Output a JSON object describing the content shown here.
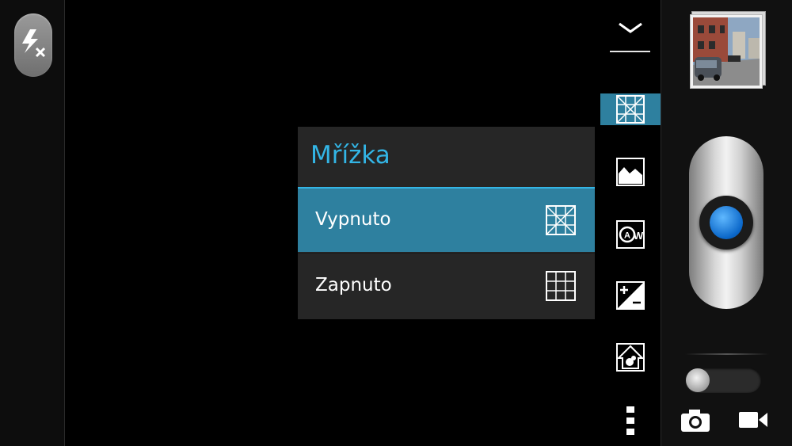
{
  "grid_menu": {
    "title": "Mřížka",
    "options": [
      {
        "label": "Vypnuto",
        "icon": "grid-off-icon",
        "selected": true
      },
      {
        "label": "Zapnuto",
        "icon": "grid-on-icon",
        "selected": false
      }
    ]
  },
  "flash": {
    "icon": "flash-off-icon"
  },
  "settings": [
    {
      "icon": "chevron-down-icon"
    },
    {
      "icon": "grid-setting-icon",
      "active": true
    },
    {
      "icon": "scene-mode-icon"
    },
    {
      "icon": "white-balance-icon"
    },
    {
      "icon": "exposure-icon"
    },
    {
      "icon": "iso-icon"
    },
    {
      "icon": "more-options-icon"
    }
  ],
  "modes": {
    "photo_icon": "camera-icon",
    "video_icon": "video-icon"
  },
  "colors": {
    "accent": "#33b5e5",
    "selected": "#2e809f",
    "popup_bg": "#262626",
    "shutter_blue": "#1a7fe0"
  }
}
